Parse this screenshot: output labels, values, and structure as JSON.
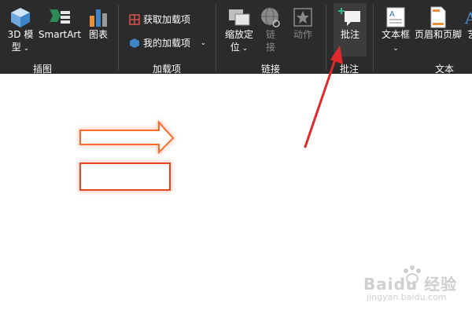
{
  "ribbon": {
    "groups": [
      {
        "label": "插图"
      },
      {
        "label": "加载项"
      },
      {
        "label": "链接"
      },
      {
        "label": "批注"
      },
      {
        "label": "文本"
      }
    ],
    "illustrations": {
      "model3d": {
        "line1": "3D 模",
        "line2": "型"
      },
      "smartart": "SmartArt",
      "chart": "图表"
    },
    "addins": {
      "get": "获取加载项",
      "mine": "我的加载项"
    },
    "links": {
      "zoom": {
        "line1": "缩放定",
        "line2": "位"
      },
      "link": {
        "line1": "链",
        "line2": "接"
      },
      "action": "动作"
    },
    "comments": {
      "comment": "批注"
    },
    "text": {
      "textbox": "文本框",
      "header_footer": "页眉和页脚",
      "wordart_partial": "艺"
    }
  },
  "watermark": {
    "brand": "Baidu 经验",
    "url": "jingyan.baidu.com"
  },
  "colors": {
    "ribbon_bg": "#2b2b2b",
    "selected_bg": "#3c3c3c",
    "arrow": "#e0292d",
    "shape_glow": "#ff6a2a"
  }
}
